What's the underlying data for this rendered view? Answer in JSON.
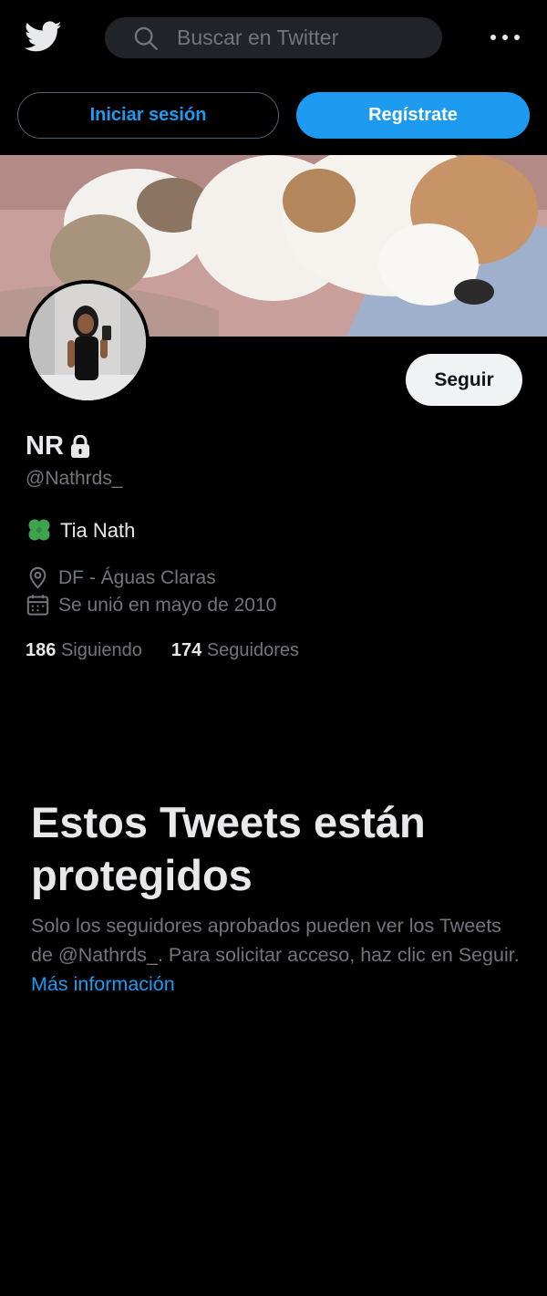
{
  "topbar": {
    "logo_icon": "twitter-bird-icon",
    "search_placeholder": "Buscar en Twitter",
    "more_icon": "more-horizontal-icon"
  },
  "auth": {
    "login_label": "Iniciar sesión",
    "signup_label": "Regístrate"
  },
  "profile": {
    "name": "NR",
    "handle": "@Nathrds_",
    "bio_emoji": "clover-icon",
    "bio": "Tia Nath",
    "location": "DF - Águas Claras",
    "joined": "Se unió en mayo de 2010",
    "following_count": "186",
    "following_label": "Siguiendo",
    "followers_count": "174",
    "followers_label": "Seguidores",
    "follow_label": "Seguir"
  },
  "protected": {
    "title": "Estos Tweets están protegidos",
    "body": "Solo los seguidores aprobados pueden ver los Tweets de @Nathrds_. Para solicitar acceso, haz clic en Seguir.",
    "link": "Más información"
  },
  "colors": {
    "accent": "#1d9bf0",
    "background": "#000000",
    "secondary_text": "#71767b",
    "primary_text": "#e7e9ea"
  }
}
